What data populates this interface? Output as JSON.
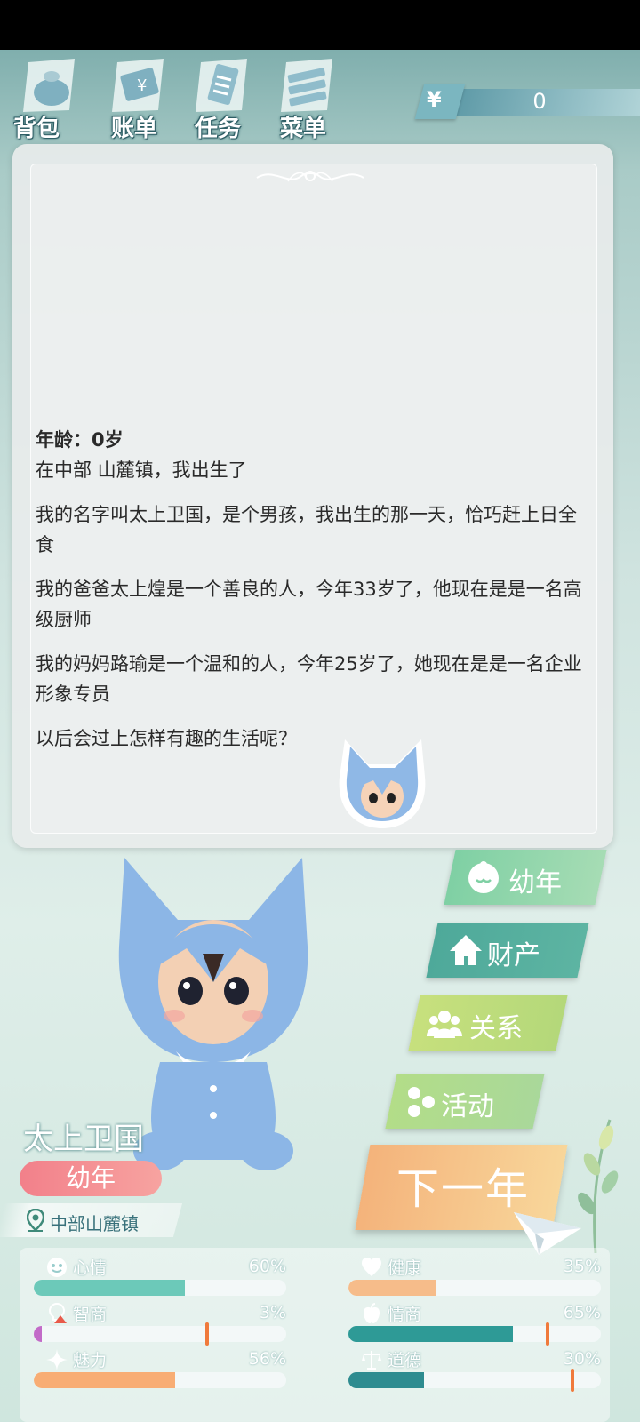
{
  "nav": {
    "bag": "背包",
    "bill": "账单",
    "tasks": "任务",
    "menu": "菜单"
  },
  "money": {
    "symbol": "¥",
    "value": "0"
  },
  "story": {
    "age": "年龄：0岁",
    "lines": [
      "在中部 山麓镇，我出生了",
      "我的名字叫太上卫国，是个男孩，我出生的那一天，恰巧赶上日全食",
      "我的爸爸太上煌是一个善良的人，今年33岁了，他现在是是一名高级厨师",
      "我的妈妈路瑜是一个温和的人，今年25岁了，她现在是是一名企业形象专员",
      "以后会过上怎样有趣的生活呢？"
    ]
  },
  "side_menu": {
    "stage": "幼年",
    "assets": "财产",
    "relations": "关系",
    "activities": "活动"
  },
  "next_year": "下一年",
  "character": {
    "name": "太上卫国",
    "stage": "幼年",
    "location": "中部山麓镇"
  },
  "stats": {
    "mood": {
      "label": "心情",
      "value": "60%",
      "fraction": 0.6,
      "color": "#6cc9b9"
    },
    "health": {
      "label": "健康",
      "value": "35%",
      "fraction": 0.35,
      "color": "#f6bc8a"
    },
    "iq": {
      "label": "智商",
      "value": "3%",
      "fraction": 0.03,
      "color": "#c26bc8",
      "marker": 0.68
    },
    "eq": {
      "label": "情商",
      "value": "65%",
      "fraction": 0.65,
      "color": "#2e9a96",
      "marker": 0.78
    },
    "charm": {
      "label": "魅力",
      "value": "56%",
      "fraction": 0.56,
      "color": "#f8ad74"
    },
    "morality": {
      "label": "道德",
      "value": "30%",
      "fraction": 0.3,
      "color": "#2e8c90",
      "marker": 0.88
    }
  }
}
